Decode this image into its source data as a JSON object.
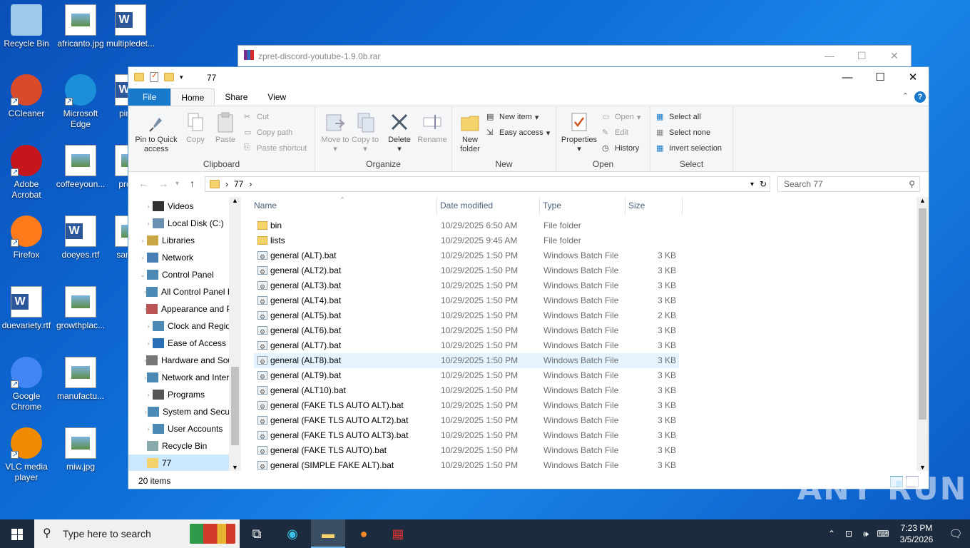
{
  "desktop": {
    "icons": [
      {
        "label": "Recycle Bin"
      },
      {
        "label": "africanto.jpg"
      },
      {
        "label": "multipledet..."
      },
      {
        "label": "CCleaner"
      },
      {
        "label": "Microsoft Edge"
      },
      {
        "label": "pink..."
      },
      {
        "label": "Adobe Acrobat"
      },
      {
        "label": "coffeeyoun..."
      },
      {
        "label": "profi..."
      },
      {
        "label": "Firefox"
      },
      {
        "label": "doeyes.rtf"
      },
      {
        "label": "same..."
      },
      {
        "label": "duevariety.rtf"
      },
      {
        "label": "growthplac..."
      },
      {
        "label": "Google Chrome"
      },
      {
        "label": "manufactu..."
      },
      {
        "label": "VLC media player"
      },
      {
        "label": "miw.jpg"
      }
    ],
    "watermark": "ANY RUN"
  },
  "rar_window": {
    "title": "zpret-discord-youtube-1.9.0b.rar"
  },
  "explorer": {
    "title": "77",
    "tabs": {
      "file": "File",
      "home": "Home",
      "share": "Share",
      "view": "View"
    },
    "ribbon": {
      "clipboard": {
        "label": "Clipboard",
        "pin": "Pin to Quick access",
        "copy": "Copy",
        "paste": "Paste",
        "cut": "Cut",
        "copy_path": "Copy path",
        "paste_shortcut": "Paste shortcut"
      },
      "organize": {
        "label": "Organize",
        "move_to": "Move to",
        "copy_to": "Copy to",
        "delete": "Delete",
        "rename": "Rename"
      },
      "new": {
        "label": "New",
        "new_folder": "New folder",
        "new_item": "New item",
        "easy_access": "Easy access"
      },
      "open": {
        "label": "Open",
        "properties": "Properties",
        "open": "Open",
        "edit": "Edit",
        "history": "History"
      },
      "select": {
        "label": "Select",
        "select_all": "Select all",
        "select_none": "Select none",
        "invert": "Invert selection"
      }
    },
    "address": {
      "path": "77"
    },
    "search": {
      "placeholder": "Search 77"
    },
    "nav": [
      {
        "label": "Videos",
        "indent": 2
      },
      {
        "label": "Local Disk (C:)",
        "indent": 2
      },
      {
        "label": "Libraries",
        "indent": 1
      },
      {
        "label": "Network",
        "indent": 1
      },
      {
        "label": "Control Panel",
        "indent": 1
      },
      {
        "label": "All Control Panel Items",
        "indent": 2
      },
      {
        "label": "Appearance and Personalization",
        "indent": 2
      },
      {
        "label": "Clock and Region",
        "indent": 2
      },
      {
        "label": "Ease of Access",
        "indent": 2
      },
      {
        "label": "Hardware and Sound",
        "indent": 2
      },
      {
        "label": "Network and Internet",
        "indent": 2
      },
      {
        "label": "Programs",
        "indent": 2
      },
      {
        "label": "System and Security",
        "indent": 2
      },
      {
        "label": "User Accounts",
        "indent": 2
      },
      {
        "label": "Recycle Bin",
        "indent": 1
      },
      {
        "label": "77",
        "indent": 1
      }
    ],
    "columns": {
      "name": "Name",
      "date": "Date modified",
      "type": "Type",
      "size": "Size"
    },
    "files": [
      {
        "name": "bin",
        "date": "10/29/2025 6:50 AM",
        "type": "File folder",
        "size": "",
        "kind": "folder"
      },
      {
        "name": "lists",
        "date": "10/29/2025 9:45 AM",
        "type": "File folder",
        "size": "",
        "kind": "folder"
      },
      {
        "name": "general (ALT).bat",
        "date": "10/29/2025 1:50 PM",
        "type": "Windows Batch File",
        "size": "3 KB",
        "kind": "bat"
      },
      {
        "name": "general (ALT2).bat",
        "date": "10/29/2025 1:50 PM",
        "type": "Windows Batch File",
        "size": "3 KB",
        "kind": "bat"
      },
      {
        "name": "general (ALT3).bat",
        "date": "10/29/2025 1:50 PM",
        "type": "Windows Batch File",
        "size": "3 KB",
        "kind": "bat"
      },
      {
        "name": "general (ALT4).bat",
        "date": "10/29/2025 1:50 PM",
        "type": "Windows Batch File",
        "size": "3 KB",
        "kind": "bat"
      },
      {
        "name": "general (ALT5).bat",
        "date": "10/29/2025 1:50 PM",
        "type": "Windows Batch File",
        "size": "2 KB",
        "kind": "bat"
      },
      {
        "name": "general (ALT6).bat",
        "date": "10/29/2025 1:50 PM",
        "type": "Windows Batch File",
        "size": "3 KB",
        "kind": "bat"
      },
      {
        "name": "general (ALT7).bat",
        "date": "10/29/2025 1:50 PM",
        "type": "Windows Batch File",
        "size": "3 KB",
        "kind": "bat"
      },
      {
        "name": "general (ALT8).bat",
        "date": "10/29/2025 1:50 PM",
        "type": "Windows Batch File",
        "size": "3 KB",
        "kind": "bat"
      },
      {
        "name": "general (ALT9).bat",
        "date": "10/29/2025 1:50 PM",
        "type": "Windows Batch File",
        "size": "3 KB",
        "kind": "bat"
      },
      {
        "name": "general (ALT10).bat",
        "date": "10/29/2025 1:50 PM",
        "type": "Windows Batch File",
        "size": "3 KB",
        "kind": "bat"
      },
      {
        "name": "general (FAKE TLS AUTO ALT).bat",
        "date": "10/29/2025 1:50 PM",
        "type": "Windows Batch File",
        "size": "3 KB",
        "kind": "bat"
      },
      {
        "name": "general (FAKE TLS AUTO ALT2).bat",
        "date": "10/29/2025 1:50 PM",
        "type": "Windows Batch File",
        "size": "3 KB",
        "kind": "bat"
      },
      {
        "name": "general (FAKE TLS AUTO ALT3).bat",
        "date": "10/29/2025 1:50 PM",
        "type": "Windows Batch File",
        "size": "3 KB",
        "kind": "bat"
      },
      {
        "name": "general (FAKE TLS AUTO).bat",
        "date": "10/29/2025 1:50 PM",
        "type": "Windows Batch File",
        "size": "3 KB",
        "kind": "bat"
      },
      {
        "name": "general (SIMPLE FAKE ALT).bat",
        "date": "10/29/2025 1:50 PM",
        "type": "Windows Batch File",
        "size": "3 KB",
        "kind": "bat"
      }
    ],
    "hovered_row": 9,
    "status": "20 items"
  },
  "taskbar": {
    "search_placeholder": "Type here to search",
    "time": "7:23 PM",
    "date": "3/5/2026"
  }
}
